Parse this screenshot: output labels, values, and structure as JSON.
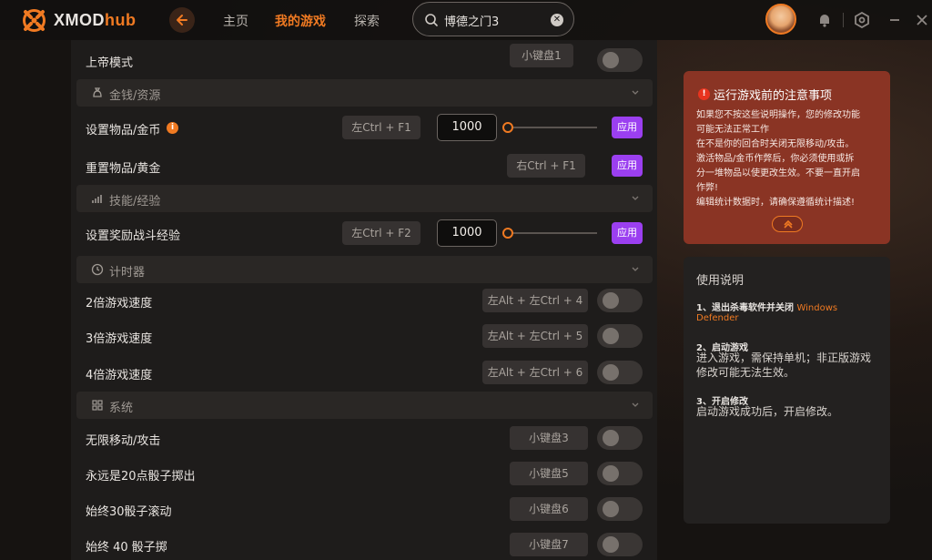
{
  "app": {
    "name_main": "XMOD",
    "name_accent": "hub",
    "accent_color": "#f07a22",
    "apply_color": "#9b3ff0"
  },
  "nav": {
    "back_icon": "arrow-left-icon",
    "items": [
      {
        "label": "主页",
        "active": false
      },
      {
        "label": "我的游戏",
        "active": true
      },
      {
        "label": "探索",
        "active": false
      }
    ]
  },
  "search": {
    "value": "博德之门3",
    "clear_icon": "close-icon"
  },
  "top_icons": [
    "avatar",
    "notification-icon",
    "settings-icon",
    "minimize-icon"
  ],
  "main": {
    "rows_top": [
      {
        "label": "上帝模式",
        "key": "小键盘1"
      }
    ],
    "sections": [
      {
        "label": "金钱/资源",
        "icon": "money-bag-icon"
      },
      {
        "label": "技能/经验",
        "icon": "bar-chart-icon"
      },
      {
        "label": "计时器",
        "icon": "clock-icon"
      },
      {
        "label": "系统",
        "icon": "grid-icon"
      }
    ],
    "money_rows": [
      {
        "label": "设置物品/金币",
        "key": "左Ctrl + F1",
        "value": "1000",
        "apply": "应用",
        "has_info": true
      },
      {
        "label": "重置物品/黄金",
        "key": "右Ctrl + F1",
        "apply": "应用"
      }
    ],
    "skill_rows": [
      {
        "label": "设置奖励战斗经验",
        "key": "左Ctrl + F2",
        "value": "1000",
        "apply": "应用"
      }
    ],
    "timer_rows": [
      {
        "label": "2倍游戏速度",
        "key": "左Alt + 左Ctrl + 4"
      },
      {
        "label": "3倍游戏速度",
        "key": "左Alt + 左Ctrl + 5"
      },
      {
        "label": "4倍游戏速度",
        "key": "左Alt + 左Ctrl + 6"
      }
    ],
    "system_rows": [
      {
        "label": "无限移动/攻击",
        "key": "小键盘3"
      },
      {
        "label": "永远是20点骰子掷出",
        "key": "小键盘5"
      },
      {
        "label": "始终30骰子滚动",
        "key": "小键盘6"
      },
      {
        "label": "始终 40 骰子掷",
        "key": "小键盘7"
      }
    ]
  },
  "notice": {
    "title": "运行游戏前的注意事项",
    "lines": [
      "如果您不按这些说明操作，您的修改功能",
      "可能无法正常工作",
      "在不是你的回合时关闭无限移动/攻击。",
      "激活物品/金币作弊后，你必须使用或拆",
      "分一堆物品以使更改生效。不要一直开启",
      "作弊!",
      "编辑统计数据时，请确保遵循统计描述!"
    ],
    "collapse_icon": "chevron-up-icon"
  },
  "guide": {
    "title": "使用说明",
    "step1_head": "1、退出杀毒软件并关闭",
    "step1_highlight": "Windows",
    "step1_highlight2": "Defender",
    "step2_head": "2、启动游戏",
    "step2_body": "进入游戏，需保持单机；非正版游戏修改可能无法生效。",
    "step3_head": "3、开启修改",
    "step3_body": "启动游戏成功后，开启修改。"
  }
}
